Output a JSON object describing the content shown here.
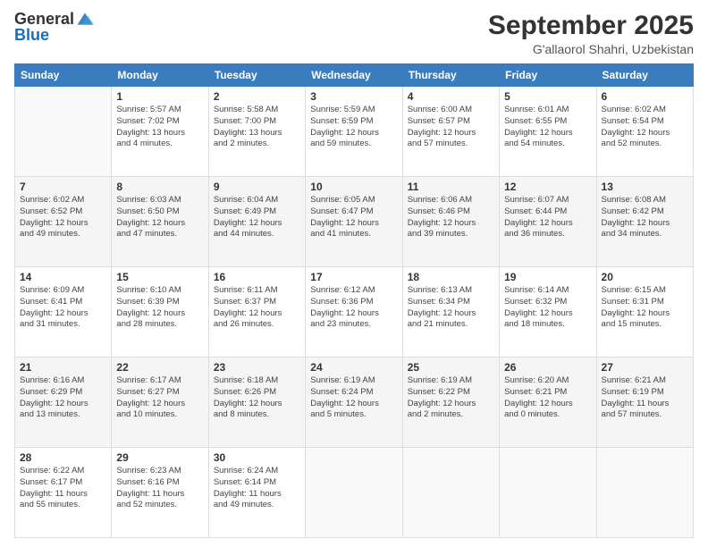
{
  "header": {
    "logo_general": "General",
    "logo_blue": "Blue",
    "month_title": "September 2025",
    "subtitle": "G'allaorol Shahri, Uzbekistan"
  },
  "days_of_week": [
    "Sunday",
    "Monday",
    "Tuesday",
    "Wednesday",
    "Thursday",
    "Friday",
    "Saturday"
  ],
  "weeks": [
    [
      {
        "day": "",
        "info": ""
      },
      {
        "day": "1",
        "info": "Sunrise: 5:57 AM\nSunset: 7:02 PM\nDaylight: 13 hours\nand 4 minutes."
      },
      {
        "day": "2",
        "info": "Sunrise: 5:58 AM\nSunset: 7:00 PM\nDaylight: 13 hours\nand 2 minutes."
      },
      {
        "day": "3",
        "info": "Sunrise: 5:59 AM\nSunset: 6:59 PM\nDaylight: 12 hours\nand 59 minutes."
      },
      {
        "day": "4",
        "info": "Sunrise: 6:00 AM\nSunset: 6:57 PM\nDaylight: 12 hours\nand 57 minutes."
      },
      {
        "day": "5",
        "info": "Sunrise: 6:01 AM\nSunset: 6:55 PM\nDaylight: 12 hours\nand 54 minutes."
      },
      {
        "day": "6",
        "info": "Sunrise: 6:02 AM\nSunset: 6:54 PM\nDaylight: 12 hours\nand 52 minutes."
      }
    ],
    [
      {
        "day": "7",
        "info": "Sunrise: 6:02 AM\nSunset: 6:52 PM\nDaylight: 12 hours\nand 49 minutes."
      },
      {
        "day": "8",
        "info": "Sunrise: 6:03 AM\nSunset: 6:50 PM\nDaylight: 12 hours\nand 47 minutes."
      },
      {
        "day": "9",
        "info": "Sunrise: 6:04 AM\nSunset: 6:49 PM\nDaylight: 12 hours\nand 44 minutes."
      },
      {
        "day": "10",
        "info": "Sunrise: 6:05 AM\nSunset: 6:47 PM\nDaylight: 12 hours\nand 41 minutes."
      },
      {
        "day": "11",
        "info": "Sunrise: 6:06 AM\nSunset: 6:46 PM\nDaylight: 12 hours\nand 39 minutes."
      },
      {
        "day": "12",
        "info": "Sunrise: 6:07 AM\nSunset: 6:44 PM\nDaylight: 12 hours\nand 36 minutes."
      },
      {
        "day": "13",
        "info": "Sunrise: 6:08 AM\nSunset: 6:42 PM\nDaylight: 12 hours\nand 34 minutes."
      }
    ],
    [
      {
        "day": "14",
        "info": "Sunrise: 6:09 AM\nSunset: 6:41 PM\nDaylight: 12 hours\nand 31 minutes."
      },
      {
        "day": "15",
        "info": "Sunrise: 6:10 AM\nSunset: 6:39 PM\nDaylight: 12 hours\nand 28 minutes."
      },
      {
        "day": "16",
        "info": "Sunrise: 6:11 AM\nSunset: 6:37 PM\nDaylight: 12 hours\nand 26 minutes."
      },
      {
        "day": "17",
        "info": "Sunrise: 6:12 AM\nSunset: 6:36 PM\nDaylight: 12 hours\nand 23 minutes."
      },
      {
        "day": "18",
        "info": "Sunrise: 6:13 AM\nSunset: 6:34 PM\nDaylight: 12 hours\nand 21 minutes."
      },
      {
        "day": "19",
        "info": "Sunrise: 6:14 AM\nSunset: 6:32 PM\nDaylight: 12 hours\nand 18 minutes."
      },
      {
        "day": "20",
        "info": "Sunrise: 6:15 AM\nSunset: 6:31 PM\nDaylight: 12 hours\nand 15 minutes."
      }
    ],
    [
      {
        "day": "21",
        "info": "Sunrise: 6:16 AM\nSunset: 6:29 PM\nDaylight: 12 hours\nand 13 minutes."
      },
      {
        "day": "22",
        "info": "Sunrise: 6:17 AM\nSunset: 6:27 PM\nDaylight: 12 hours\nand 10 minutes."
      },
      {
        "day": "23",
        "info": "Sunrise: 6:18 AM\nSunset: 6:26 PM\nDaylight: 12 hours\nand 8 minutes."
      },
      {
        "day": "24",
        "info": "Sunrise: 6:19 AM\nSunset: 6:24 PM\nDaylight: 12 hours\nand 5 minutes."
      },
      {
        "day": "25",
        "info": "Sunrise: 6:19 AM\nSunset: 6:22 PM\nDaylight: 12 hours\nand 2 minutes."
      },
      {
        "day": "26",
        "info": "Sunrise: 6:20 AM\nSunset: 6:21 PM\nDaylight: 12 hours\nand 0 minutes."
      },
      {
        "day": "27",
        "info": "Sunrise: 6:21 AM\nSunset: 6:19 PM\nDaylight: 11 hours\nand 57 minutes."
      }
    ],
    [
      {
        "day": "28",
        "info": "Sunrise: 6:22 AM\nSunset: 6:17 PM\nDaylight: 11 hours\nand 55 minutes."
      },
      {
        "day": "29",
        "info": "Sunrise: 6:23 AM\nSunset: 6:16 PM\nDaylight: 11 hours\nand 52 minutes."
      },
      {
        "day": "30",
        "info": "Sunrise: 6:24 AM\nSunset: 6:14 PM\nDaylight: 11 hours\nand 49 minutes."
      },
      {
        "day": "",
        "info": ""
      },
      {
        "day": "",
        "info": ""
      },
      {
        "day": "",
        "info": ""
      },
      {
        "day": "",
        "info": ""
      }
    ]
  ]
}
